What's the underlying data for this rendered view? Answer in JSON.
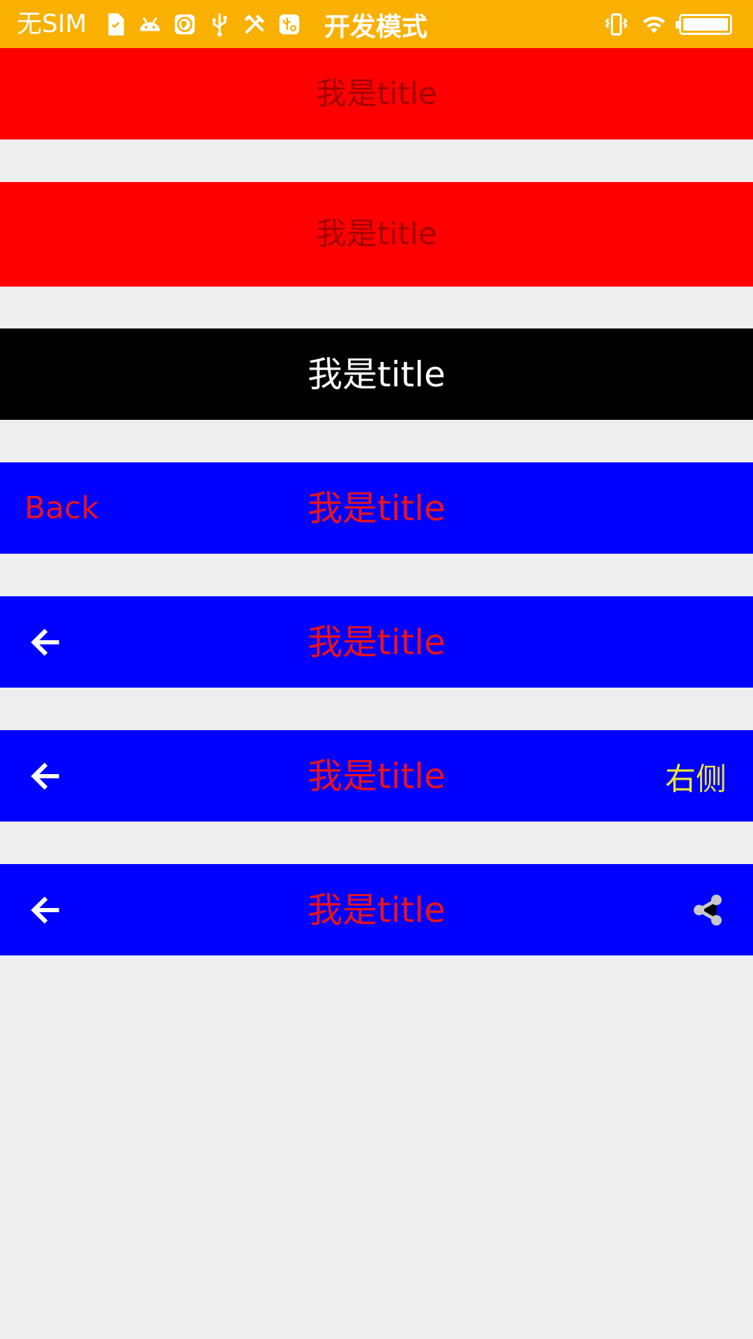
{
  "status_bar": {
    "carrier": "无SIM",
    "mode_label": "开发模式",
    "left_icons": [
      "sim-card-check-icon",
      "android-icon",
      "vpn-globe-icon",
      "usb-icon",
      "tools-icon",
      "usb-debug-icon"
    ],
    "right_icons": [
      "vibrate-icon",
      "wifi-icon",
      "battery-icon"
    ],
    "battery_level": 1.0
  },
  "bars": [
    {
      "title": "我是title",
      "background": "#ff0000",
      "title_color": "#a30000"
    },
    {
      "title": "我是title",
      "background": "#ff0000",
      "title_color": "#a30000"
    },
    {
      "title": "我是title",
      "background": "#000000",
      "title_color": "#ffffff"
    },
    {
      "title": "我是title",
      "background": "#0000ff",
      "title_color": "#e8131c",
      "left_text": "Back"
    },
    {
      "title": "我是title",
      "background": "#0000ff",
      "title_color": "#e8131c",
      "left_icon": "arrow-left-icon"
    },
    {
      "title": "我是title",
      "background": "#0000ff",
      "title_color": "#e8131c",
      "left_icon": "arrow-left-icon",
      "right_text": "右侧"
    },
    {
      "title": "我是title",
      "background": "#0000ff",
      "title_color": "#e8131c",
      "left_icon": "arrow-left-icon",
      "right_icon": "share-icon"
    }
  ],
  "colors": {
    "status_bar": "#f9b000",
    "page_background": "#eeeeee",
    "right_text": "#e8e53b",
    "share_icon": "#c9c9c9"
  }
}
